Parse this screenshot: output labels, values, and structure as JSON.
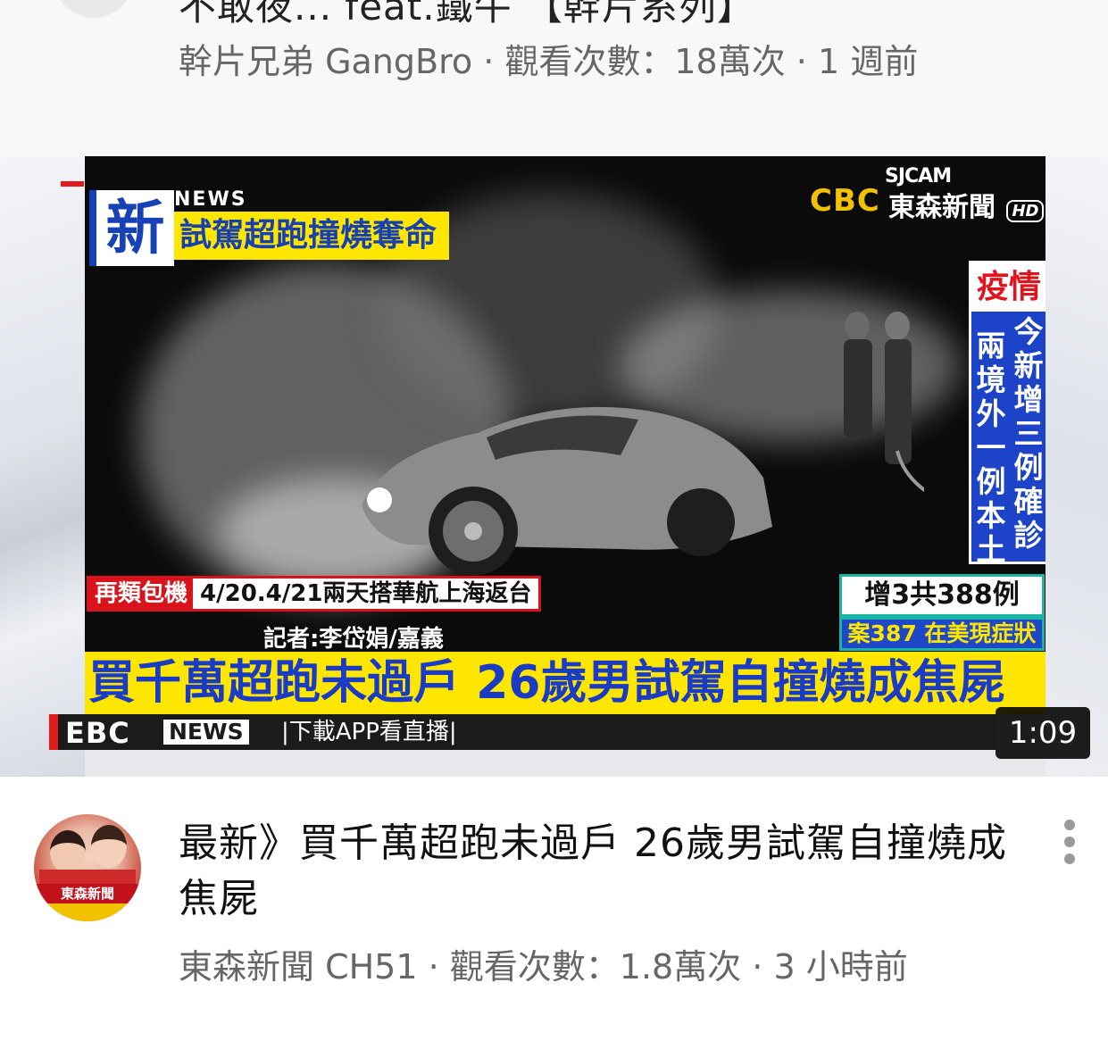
{
  "previous_video": {
    "title": "不敢夜... feat.鐵牛 【幹片系列】",
    "meta": "幹片兄弟 GangBro · 觀看次數：18萬次 · 1 週前"
  },
  "thumbnail": {
    "badge_new": "新",
    "badge_news": "NEWS",
    "headline_top": "試駕超跑撞燒奪命",
    "logo_sjcam": "SJCAM",
    "logo_cbc": "CBC",
    "logo_station": "東森新聞",
    "logo_hd": "HD",
    "epidemic_title": "疫情",
    "epidemic_col1": "今新增三例確診",
    "epidemic_col2": "兩境外一例本土",
    "epidemic_count": "增3共388例",
    "epidemic_case": "案387 在美現症狀",
    "charter_tag": "再類包機",
    "charter_text": "4/20.4/21兩天搭華航上海返台",
    "reporter": "記者:李岱娟/嘉義",
    "main_headline": "買千萬超跑未過戶 26歲男試駕自撞燒成焦屍",
    "ticker_logo": "EBC",
    "ticker_news": "NEWS",
    "ticker_text": "|下載APP看直播|",
    "duration": "1:09"
  },
  "current_video": {
    "channel_avatar_banner": "東森新聞",
    "title": "最新》買千萬超跑未過戶 26歲男試駕自撞燒成焦屍",
    "meta": "東森新聞 CH51 · 觀看次數：1.8萬次 · 3 小時前"
  },
  "icons": {
    "more": "more-vert-icon"
  },
  "colors": {
    "headline_yellow": "#ffe600",
    "headline_blue": "#1a3bc4",
    "alert_red": "#d8131b",
    "meta_gray": "#666666"
  }
}
